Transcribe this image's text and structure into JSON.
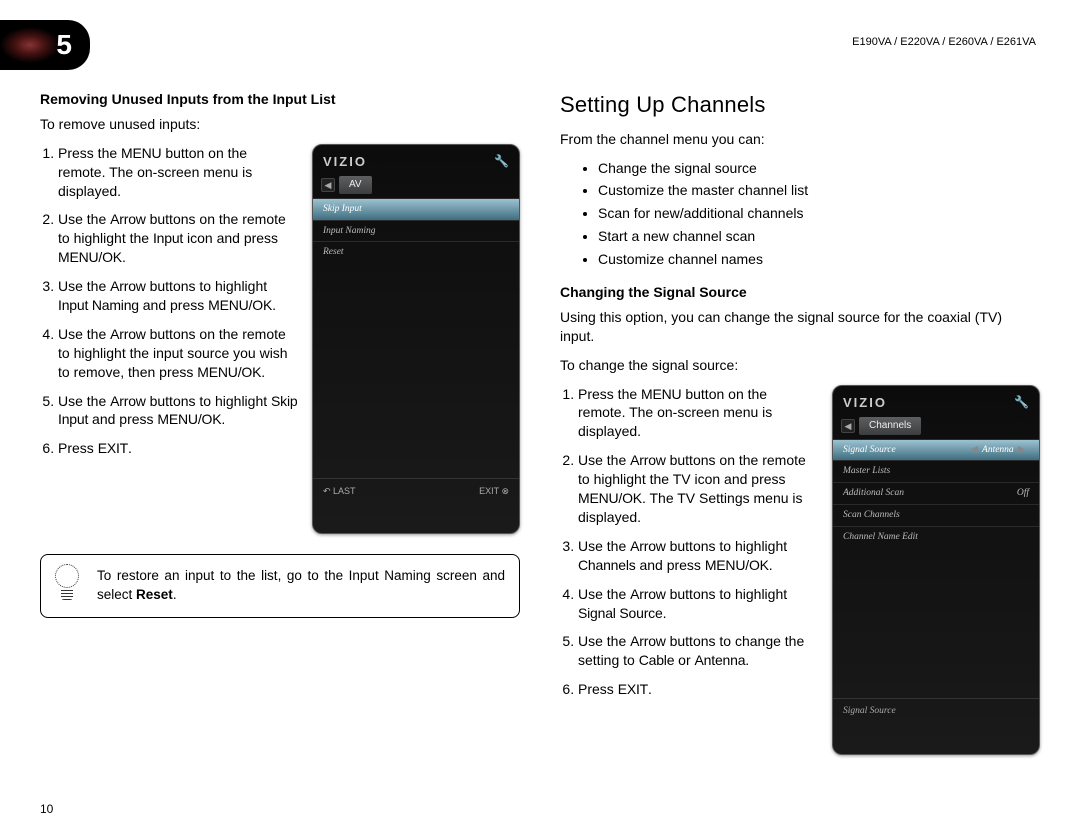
{
  "chapter": "5",
  "models": "E190VA / E220VA / E260VA / E261VA",
  "page_number": "10",
  "left": {
    "h_bold": "Removing Unused Inputs from the Input List",
    "intro": "To remove unused inputs:",
    "steps": [
      "Press the MENU button on the remote. The on-screen menu is displayed.",
      "Use the Arrow buttons on the remote to highlight the Input icon and press MENU/OK.",
      "Use the Arrow buttons to highlight Input Naming and press MENU/OK.",
      "Use the Arrow buttons on the remote to highlight the input source you wish to remove, then press MENU/OK.",
      "Use the Arrow buttons to highlight Skip Input and press MENU/OK.",
      "Press EXIT."
    ],
    "tip_a": "To restore an input to the list, go to the Input Naming screen and select ",
    "tip_b": "Reset",
    "tip_c": "."
  },
  "left_tv": {
    "logo": "VIZIO",
    "tab": "AV",
    "rows": [
      "Skip Input",
      "Input Naming",
      "Reset"
    ],
    "footer_left": "↶ LAST",
    "footer_right": "EXIT ⊗"
  },
  "right": {
    "h2": "Setting Up Channels",
    "intro": "From the channel menu you can:",
    "bullets": [
      "Change the signal source",
      "Customize the master channel list",
      "Scan for new/additional channels",
      "Start a new channel scan",
      "Customize channel names"
    ],
    "h_bold": "Changing the Signal Source",
    "desc": "Using this option, you can change the signal source for the coaxial (TV) input.",
    "intro2": "To change the signal source:",
    "steps": [
      "Press the MENU button on the remote. The on-screen menu is displayed.",
      "Use the Arrow buttons on the remote to highlight the TV icon and press MENU/OK. The TV Settings menu is displayed.",
      "Use the Arrow buttons to highlight Channels and press MENU/OK.",
      "Use the Arrow buttons to highlight Signal Source.",
      "Use the Arrow buttons to change the setting to Cable or Antenna.",
      "Press EXIT."
    ]
  },
  "right_tv": {
    "logo": "VIZIO",
    "tab": "Channels",
    "rows": [
      {
        "l": "Signal Source",
        "r": "Antenna",
        "sel": true,
        "arrows": true
      },
      {
        "l": "Master Lists",
        "r": ""
      },
      {
        "l": "Additional Scan",
        "r": "Off"
      },
      {
        "l": "Scan Channels",
        "r": ""
      },
      {
        "l": "Channel Name Edit",
        "r": ""
      }
    ],
    "status": "Signal Source"
  }
}
